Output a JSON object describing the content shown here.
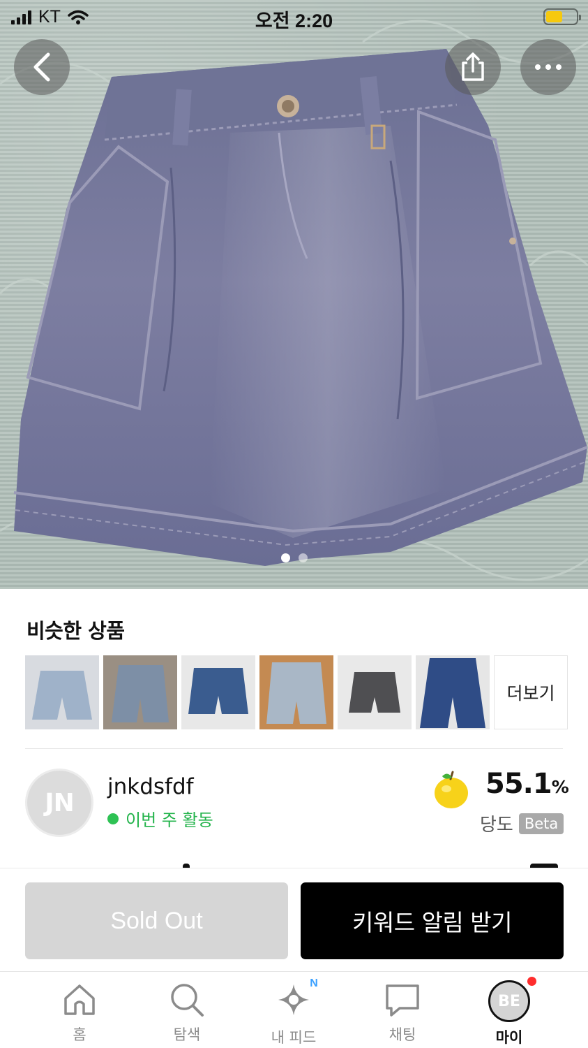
{
  "status_bar": {
    "carrier": "KT",
    "time": "오전 2:20",
    "battery_level": 0.55,
    "battery_color": "#f6c90e"
  },
  "nav": {
    "back_icon": "chevron-left-icon",
    "share_icon": "share-icon",
    "more_icon": "more-horizontal-icon"
  },
  "gallery": {
    "page_count": 2,
    "current_page": 1
  },
  "similar": {
    "title": "비슷한 상품",
    "more_label": "더보기",
    "items": [
      {
        "color": "#9fb2c9"
      },
      {
        "color": "#7d8fa6"
      },
      {
        "color": "#3a5c8f"
      },
      {
        "color": "#a9b7c6"
      },
      {
        "color": "#4f4f52"
      },
      {
        "color": "#2f4c86"
      }
    ]
  },
  "seller": {
    "initials": "JN",
    "name": "jnkdsfdf",
    "activity": "이번 주 활동",
    "activity_color": "#2ec254",
    "sweetness_value": "55.1",
    "sweetness_unit": "%",
    "sweetness_label": "당도",
    "beta_label": "Beta"
  },
  "actions": {
    "sold_out_label": "Sold Out",
    "keyword_alert_label": "키워드 알림 받기"
  },
  "tab_bar": {
    "tabs": [
      {
        "label": "홈",
        "icon": "home-icon"
      },
      {
        "label": "탐색",
        "icon": "search-icon"
      },
      {
        "label": "내 피드",
        "icon": "sparkle-icon",
        "badge": "N"
      },
      {
        "label": "채팅",
        "icon": "chat-icon"
      },
      {
        "label": "마이",
        "icon": "avatar",
        "initials": "BE",
        "active": true
      }
    ]
  }
}
